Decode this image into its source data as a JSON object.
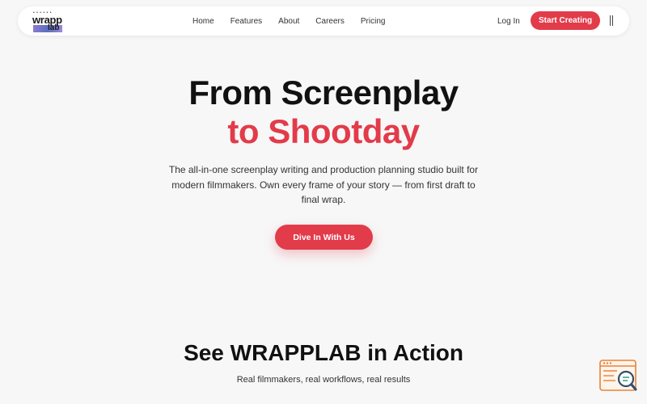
{
  "nav": {
    "logo_top": "• • • • • •",
    "logo_wrapp": "wrapp",
    "logo_lab": "lab",
    "links": [
      "Home",
      "Features",
      "About",
      "Careers",
      "Pricing"
    ],
    "login": "Log In",
    "cta": "Start Creating"
  },
  "hero": {
    "title_line1": "From Screenplay",
    "title_line2": "to Shootday",
    "subtitle": "The all-in-one screenplay writing and production planning studio built for modern filmmakers. Own every frame of your story — from first draft to final wrap.",
    "cta": "Dive In With Us"
  },
  "section": {
    "title": "See WRAPPLAB in Action",
    "subtitle": "Real filmmakers, real workflows, real results"
  },
  "colors": {
    "accent": "#e23b4a",
    "background": "#f7f7f7",
    "widget": "#e8823a"
  },
  "icons": {
    "menu": "menu-icon",
    "widget": "search-chat-icon"
  }
}
